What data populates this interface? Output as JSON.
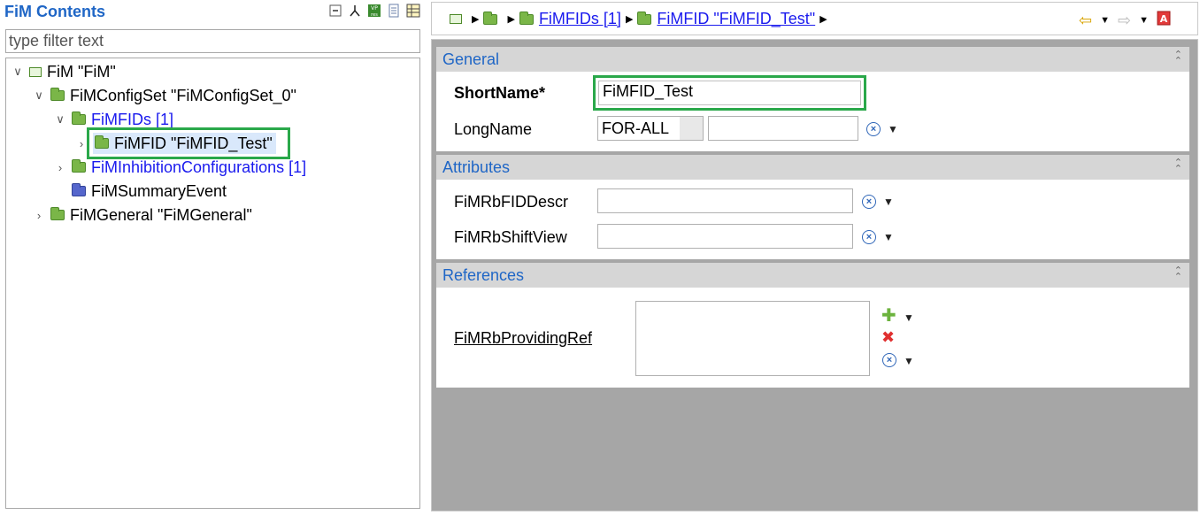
{
  "left_panel": {
    "title": "FiM Contents",
    "filter_placeholder": "type filter text",
    "tree": [
      {
        "label": "FiM \"FiM\"",
        "twisty": "∨"
      },
      {
        "label": "FiMConfigSet \"FiMConfigSet_0\"",
        "twisty": "∨"
      },
      {
        "label": "FiMFIDs [1]",
        "twisty": "∨"
      },
      {
        "label": "FiMFID \"FiMFID_Test\"",
        "twisty": "›"
      },
      {
        "label": "FiMInhibitionConfigurations [1]",
        "twisty": "›"
      },
      {
        "label": "FiMSummaryEvent",
        "twisty": ""
      },
      {
        "label": "FiMGeneral \"FiMGeneral\"",
        "twisty": "›"
      }
    ]
  },
  "breadcrumb": {
    "items": [
      "FiMFIDs [1]",
      "FiMFID \"FiMFID_Test\""
    ]
  },
  "sections": {
    "general": {
      "title": "General",
      "shortname_label": "ShortName*",
      "shortname_value": "FiMFID_Test",
      "longname_label": "LongName",
      "longname_lang": "FOR-ALL",
      "longname_value": ""
    },
    "attributes": {
      "title": "Attributes",
      "field1_label": "FiMRbFIDDescr",
      "field1_value": "",
      "field2_label": "FiMRbShiftView",
      "field2_value": ""
    },
    "references": {
      "title": "References",
      "ref_label": "FiMRbProvidingRef"
    }
  },
  "colors": {
    "accent_blue": "#1f66c6",
    "highlight_green": "#2aa84a",
    "editor_bg": "#a6a6a6"
  }
}
